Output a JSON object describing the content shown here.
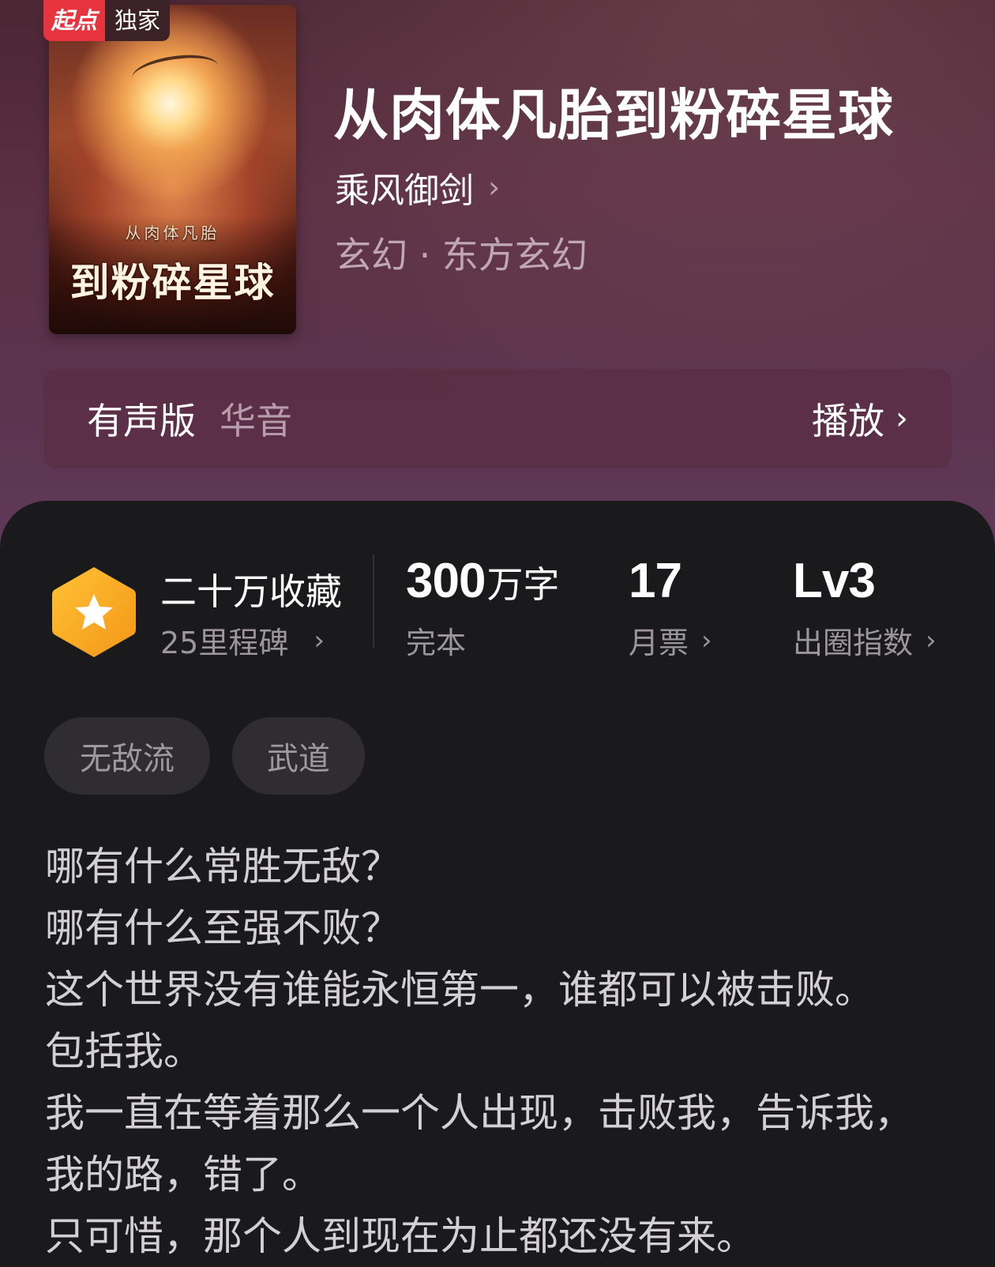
{
  "badge": {
    "brand": "起点",
    "label": "独家"
  },
  "cover": {
    "small_title": "从肉体凡胎",
    "big_title": "到粉碎星球"
  },
  "book": {
    "title": "从肉体凡胎到粉碎星球",
    "author": "乘风御剑",
    "genre": "玄幻 · 东方玄幻"
  },
  "audio": {
    "label": "有声版",
    "narrator": "华音",
    "play": "播放"
  },
  "stats": {
    "favorites": "二十万收藏",
    "milestones": "25里程碑",
    "words_value": "300",
    "words_unit": "万字",
    "status": "完本",
    "votes_value": "17",
    "votes_label": "月票",
    "level_value": "Lv3",
    "level_label": "出圈指数"
  },
  "tags": [
    "无敌流",
    "武道"
  ],
  "synopsis": [
    "哪有什么常胜无敌？",
    "哪有什么至强不败？",
    "这个世界没有谁能永恒第一，谁都可以被击败。",
    "包括我。",
    "我一直在等着那么一个人出现，击败我，告诉我，",
    "我的路，错了。",
    "只可惜，那个人到现在为止都还没有来。"
  ],
  "icons": {
    "chevron": "chevron-right-icon",
    "milestone": "star-hexagon-icon"
  },
  "colors": {
    "header_bg": "#5a2f42",
    "panel_bg": "#1a191b",
    "badge_red": "#e8343e",
    "hex_orange": "#f6a623"
  }
}
